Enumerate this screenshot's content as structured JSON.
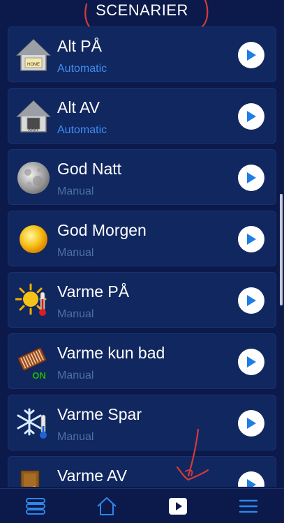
{
  "header": {
    "title": "SCENARIER"
  },
  "colors": {
    "background": "#0b1a4a",
    "row_background": "#11275f",
    "accent_blue": "#3e8ef2",
    "manual_text": "#4c6fa8",
    "annotation_red": "#d63a3a"
  },
  "scenes": [
    {
      "name": "Alt PÅ",
      "mode": "Automatic",
      "icon": "house-home-icon",
      "icon_label": "HOME"
    },
    {
      "name": "Alt AV",
      "mode": "Automatic",
      "icon": "house-away-icon",
      "icon_label": "AWAY"
    },
    {
      "name": "God Natt",
      "mode": "Manual",
      "icon": "moon-icon"
    },
    {
      "name": "God Morgen",
      "mode": "Manual",
      "icon": "sun-icon"
    },
    {
      "name": "Varme PÅ",
      "mode": "Manual",
      "icon": "sun-thermometer-icon"
    },
    {
      "name": "Varme kun bad",
      "mode": "Manual",
      "icon": "heater-on-icon",
      "icon_label": "ON"
    },
    {
      "name": "Varme Spar",
      "mode": "Manual",
      "icon": "snowflake-thermometer-icon"
    },
    {
      "name": "Varme AV",
      "mode": "",
      "icon": "door-exit-icon"
    }
  ],
  "bottom_nav": [
    {
      "icon": "devices-list-icon"
    },
    {
      "icon": "home-icon"
    },
    {
      "icon": "scenes-play-icon"
    },
    {
      "icon": "menu-icon"
    }
  ]
}
